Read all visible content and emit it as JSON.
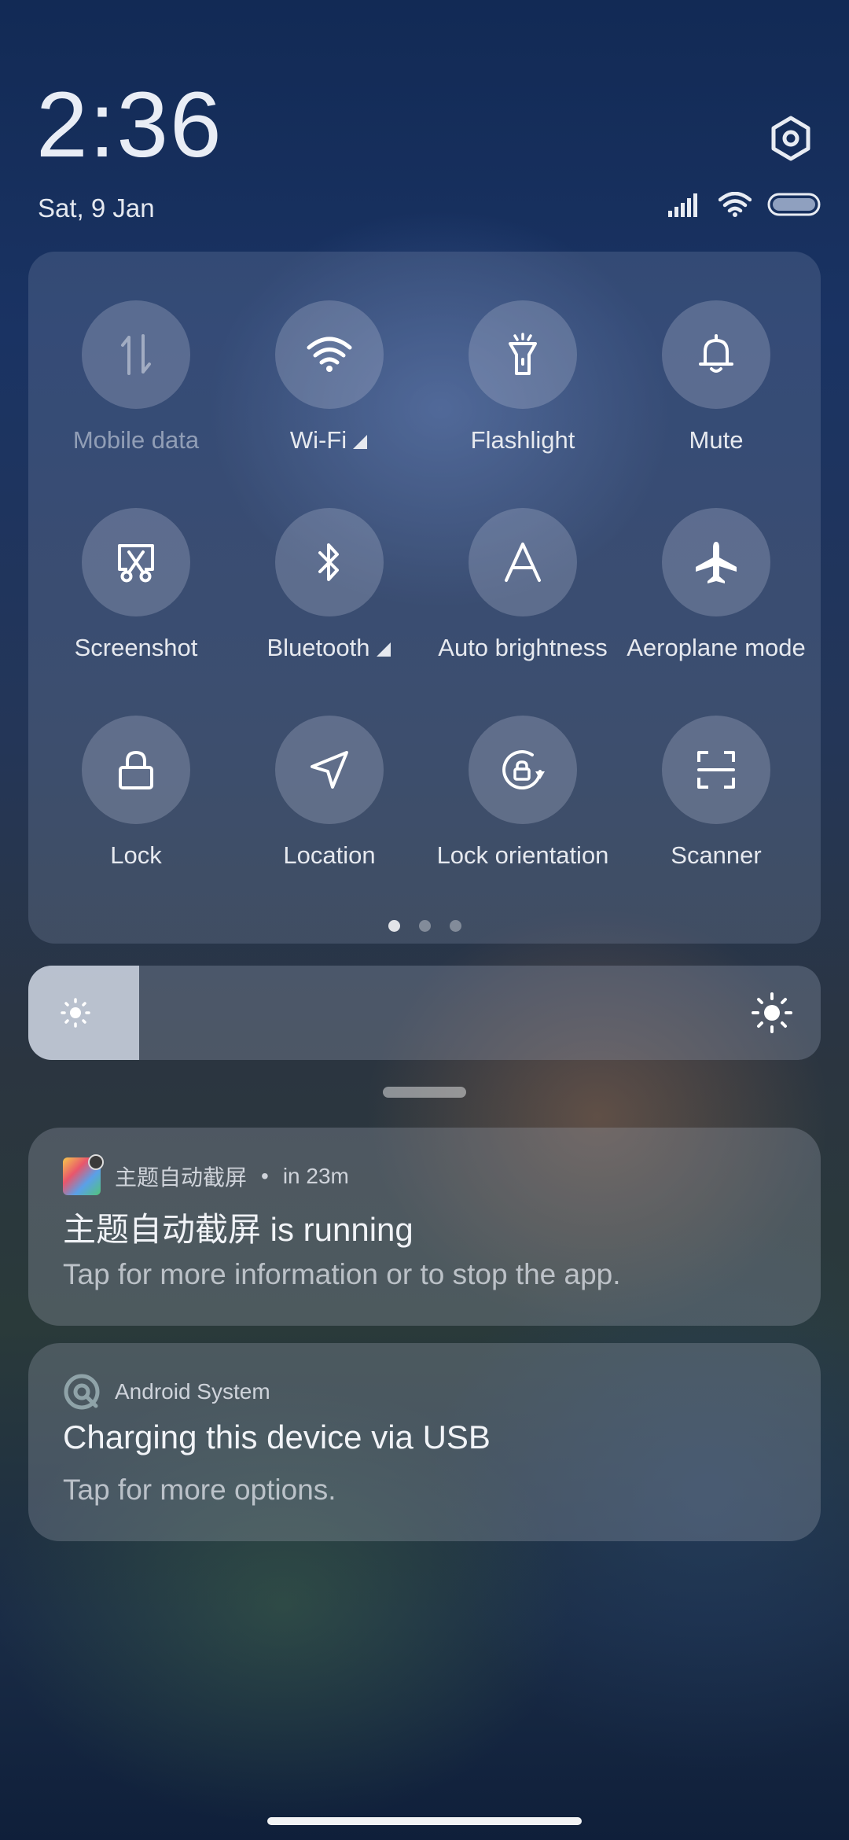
{
  "header": {
    "time": "2:36",
    "date": "Sat, 9 Jan"
  },
  "quick_settings": {
    "tiles": [
      {
        "label": "Mobile data",
        "icon": "mobile-data-icon",
        "state": "off"
      },
      {
        "label": "Wi-Fi",
        "icon": "wifi-icon",
        "state": "on"
      },
      {
        "label": "Flashlight",
        "icon": "flashlight-icon",
        "state": "off"
      },
      {
        "label": "Mute",
        "icon": "bell-icon",
        "state": "off"
      },
      {
        "label": "Screenshot",
        "icon": "screenshot-scissors-icon",
        "state": "off"
      },
      {
        "label": "Bluetooth",
        "icon": "bluetooth-icon",
        "state": "off"
      },
      {
        "label": "Auto brightness",
        "icon": "auto-brightness-icon",
        "state": "off"
      },
      {
        "label": "Aeroplane mode",
        "icon": "aeroplane-icon",
        "state": "off"
      },
      {
        "label": "Lock",
        "icon": "lock-icon",
        "state": "off"
      },
      {
        "label": "Location",
        "icon": "location-arrow-icon",
        "state": "off"
      },
      {
        "label": "Lock orientation",
        "icon": "rotation-lock-icon",
        "state": "off"
      },
      {
        "label": "Scanner",
        "icon": "scanner-icon",
        "state": "off"
      }
    ],
    "page_count": 3,
    "active_page": 1
  },
  "brightness": {
    "level_fraction": 0.14
  },
  "notifications": [
    {
      "app": "主题自动截屏",
      "time": "in 23m",
      "title": "主题自动截屏 is running",
      "body": "Tap for more information or to stop the app."
    },
    {
      "app": "Android System",
      "title": "Charging this device via USB",
      "body": "Tap for more options."
    }
  ]
}
